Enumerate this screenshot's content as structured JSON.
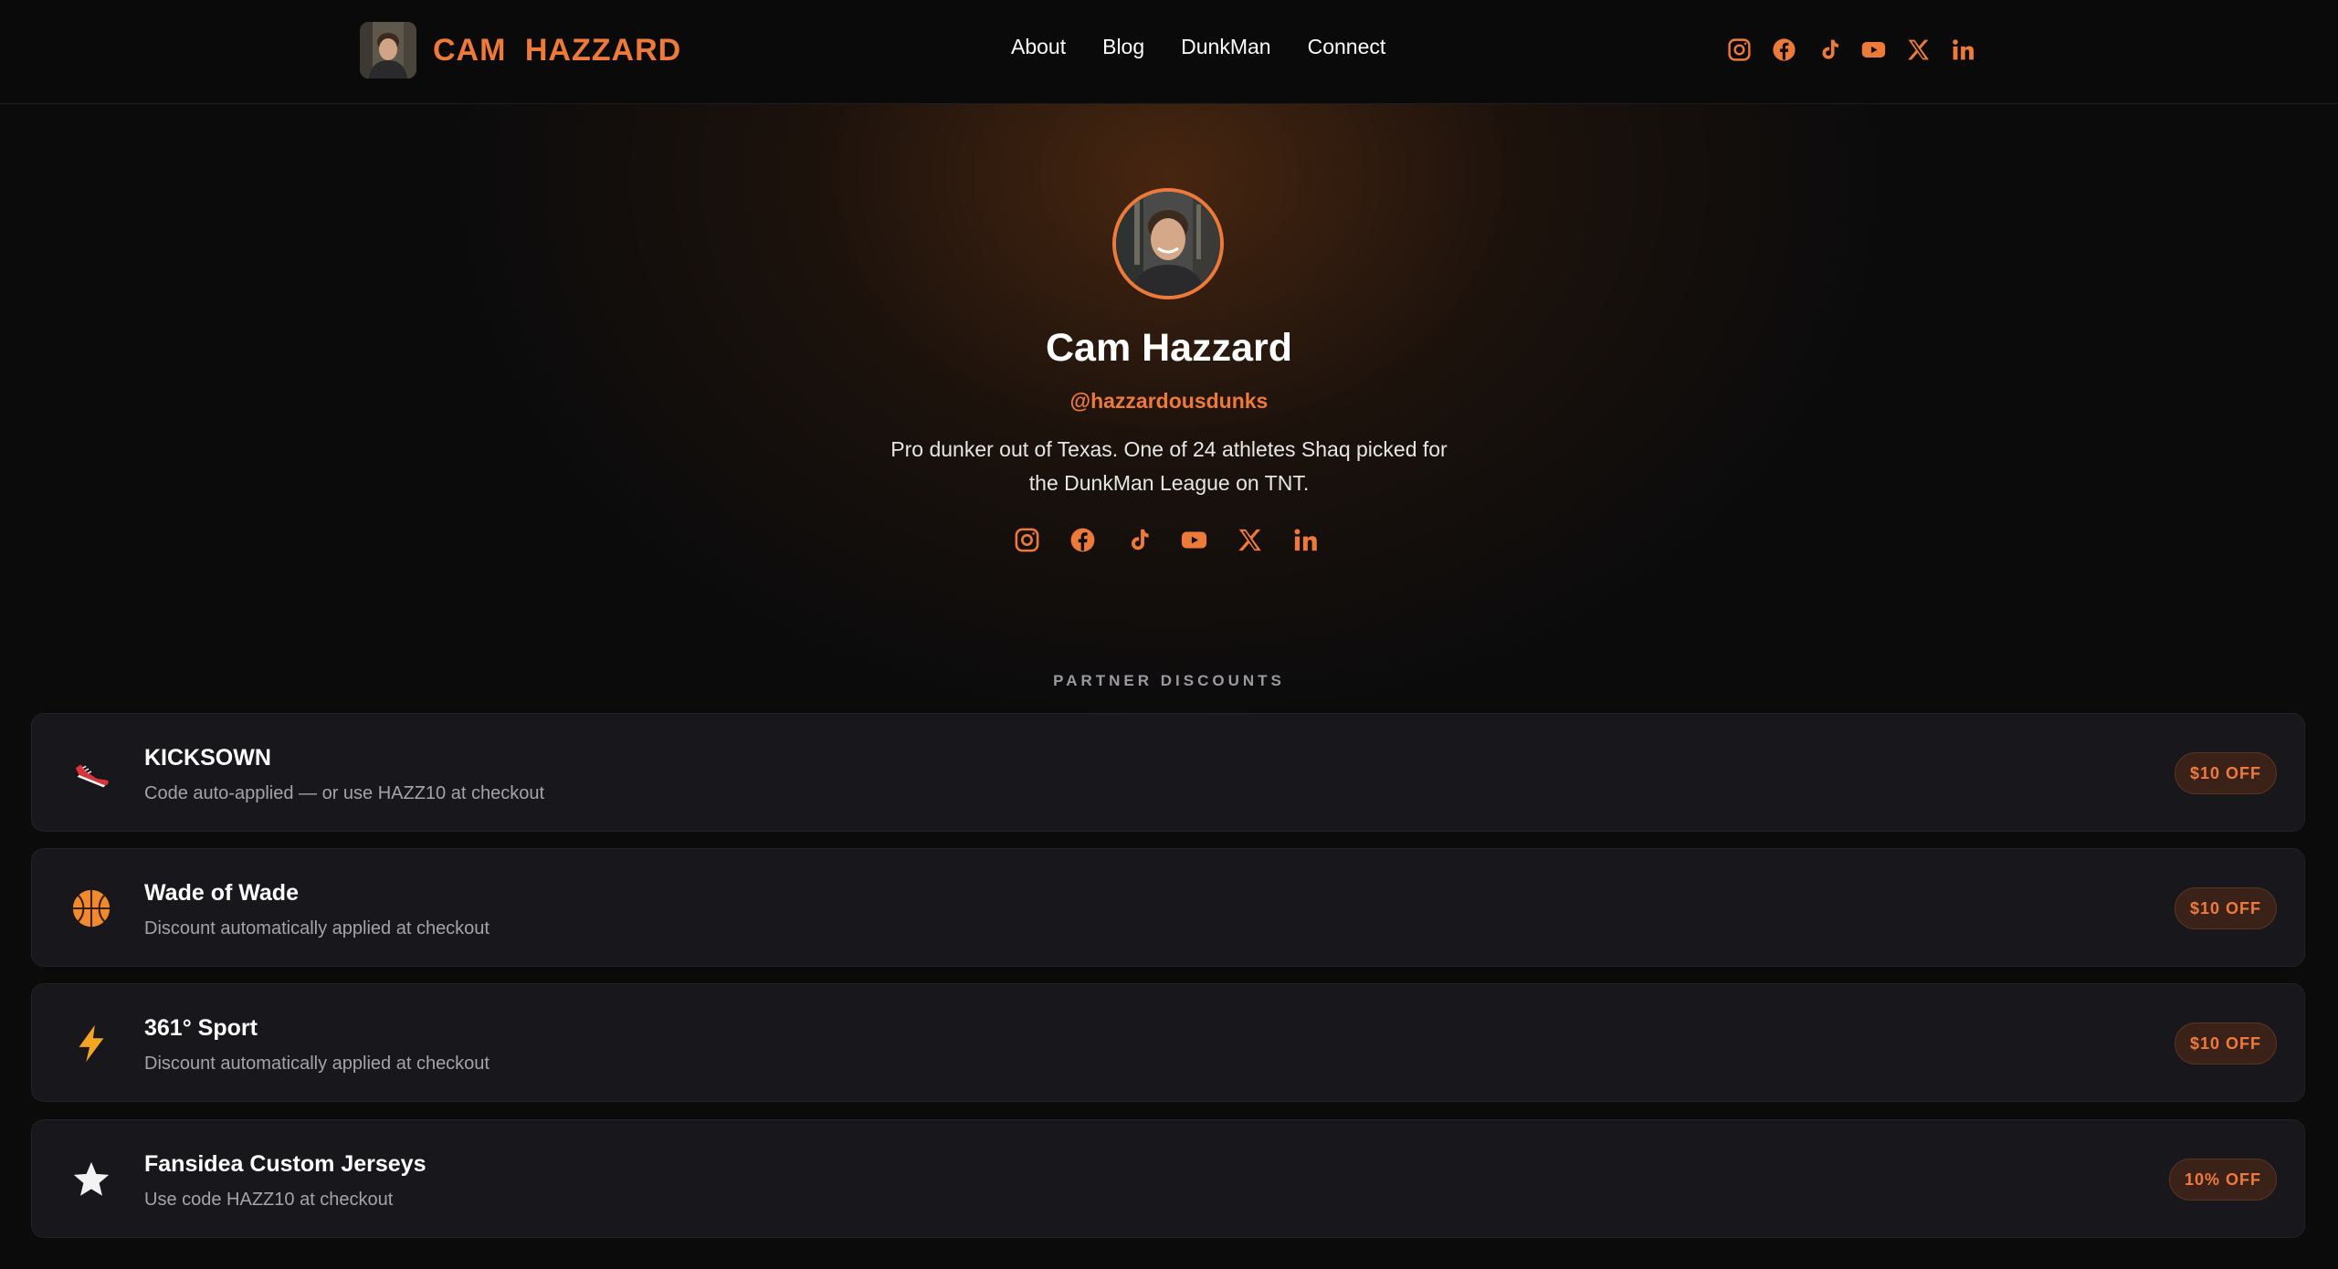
{
  "colors": {
    "accent": "#ee7a3a",
    "background": "#0b0b0c",
    "card": "#18181c",
    "badge_bg": "#3a2219"
  },
  "nav": {
    "brand": "CAM HAZZARD",
    "links": [
      {
        "label": "About"
      },
      {
        "label": "Blog"
      },
      {
        "label": "DunkMan"
      },
      {
        "label": "Connect"
      }
    ],
    "social_icons": [
      "instagram-icon",
      "facebook-icon",
      "tiktok-icon",
      "youtube-icon",
      "x-icon",
      "linkedin-icon"
    ]
  },
  "hero": {
    "name": "Cam Hazzard",
    "handle": "@hazzardousdunks",
    "bio": "Pro dunker out of Texas. One of 24 athletes Shaq picked for the DunkMan League on TNT.",
    "social_icons": [
      "instagram-icon",
      "facebook-icon",
      "tiktok-icon",
      "youtube-icon",
      "x-icon",
      "linkedin-icon"
    ]
  },
  "partners": {
    "label": "PARTNER DISCOUNTS",
    "items": [
      {
        "icon": "sneaker-icon",
        "title": "KICKSOWN",
        "subtitle": "Code auto-applied — or use HAZZ10 at checkout",
        "badge": "$10 OFF"
      },
      {
        "icon": "basketball-icon",
        "title": "Wade of Wade",
        "subtitle": "Discount automatically applied at checkout",
        "badge": "$10 OFF"
      },
      {
        "icon": "lightning-icon",
        "title": "361° Sport",
        "subtitle": "Discount automatically applied at checkout",
        "badge": "$10 OFF"
      },
      {
        "icon": "star-icon",
        "title": "Fansidea Custom Jerseys",
        "subtitle": "Use code HAZZ10 at checkout",
        "badge": "10% OFF"
      }
    ]
  }
}
